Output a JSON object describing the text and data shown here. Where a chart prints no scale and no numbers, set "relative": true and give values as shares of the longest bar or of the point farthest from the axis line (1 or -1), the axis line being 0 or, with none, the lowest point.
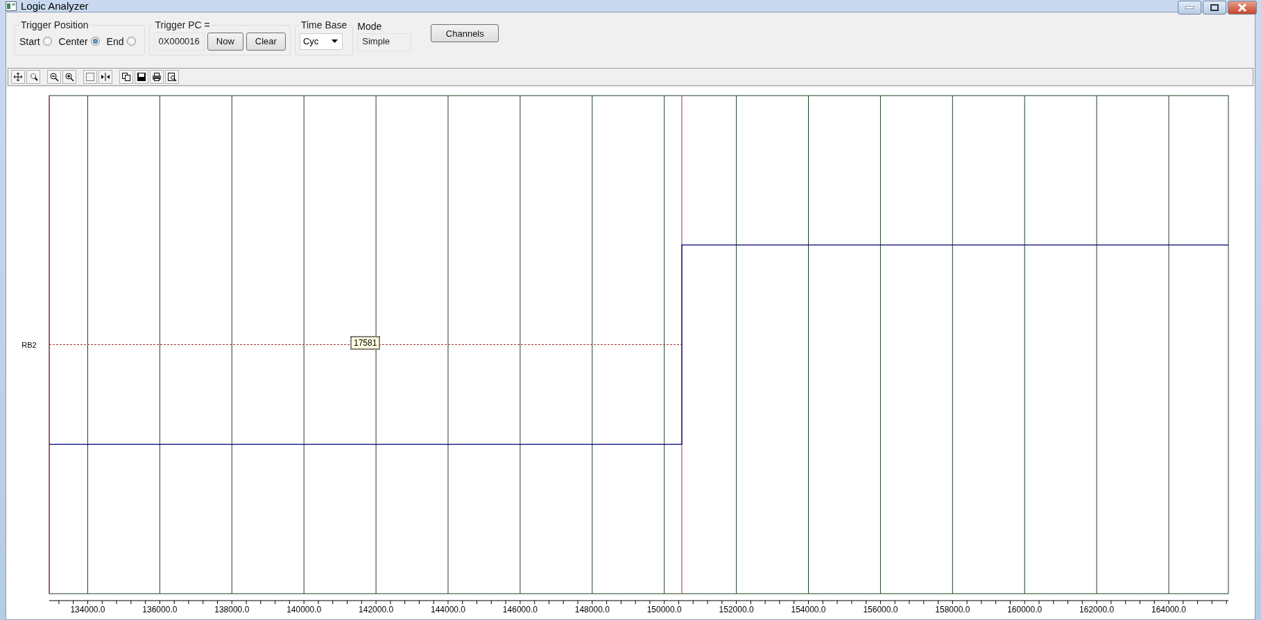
{
  "window": {
    "title": "Logic Analyzer"
  },
  "trigger_position": {
    "label": "Trigger Position",
    "options": [
      {
        "label": "Start",
        "selected": false
      },
      {
        "label": "Center",
        "selected": true
      },
      {
        "label": "End",
        "selected": false
      }
    ]
  },
  "trigger_pc": {
    "label": "Trigger PC =",
    "value": "0X000016",
    "buttons": [
      "Now",
      "Clear"
    ]
  },
  "time_base": {
    "label": "Time Base",
    "value": "Cyc"
  },
  "mode": {
    "label": "Mode",
    "value": "Simple"
  },
  "channels_button": "Channels",
  "plot": {
    "tooltip": "17581",
    "chart_data": {
      "type": "line",
      "grid": true,
      "relative": true,
      "x": [
        132932,
        150487,
        150487,
        165655
      ],
      "series": [
        {
          "name": "RB2",
          "color": "#000080",
          "values": [
            0,
            0,
            1,
            1
          ]
        }
      ],
      "xlim": [
        132932,
        165655
      ],
      "xticks": [
        {
          "value": 134000,
          "label": "134000.0"
        },
        {
          "value": 136000,
          "label": "136000.0"
        },
        {
          "value": 138000,
          "label": "138000.0"
        },
        {
          "value": 140000,
          "label": "140000.0"
        },
        {
          "value": 142000,
          "label": "142000.0"
        },
        {
          "value": 144000,
          "label": "144000.0"
        },
        {
          "value": 146000,
          "label": "146000.0"
        },
        {
          "value": 148000,
          "label": "148000.0"
        },
        {
          "value": 150000,
          "label": "150000.0"
        },
        {
          "value": 152000,
          "label": "152000.0"
        },
        {
          "value": 154000,
          "label": "154000.0"
        },
        {
          "value": 156000,
          "label": "156000.0"
        },
        {
          "value": 158000,
          "label": "158000.0"
        },
        {
          "value": 160000,
          "label": "160000.0"
        },
        {
          "value": 162000,
          "label": "162000.0"
        },
        {
          "value": 164000,
          "label": "164000.0"
        }
      ],
      "ref_lines": [
        {
          "axis": "x",
          "value": 132932,
          "color": "#a03030"
        },
        {
          "axis": "x",
          "value": 150487,
          "color": "#a03030"
        },
        {
          "axis": "y",
          "value": 0.5,
          "color": "#a03030"
        }
      ]
    }
  }
}
